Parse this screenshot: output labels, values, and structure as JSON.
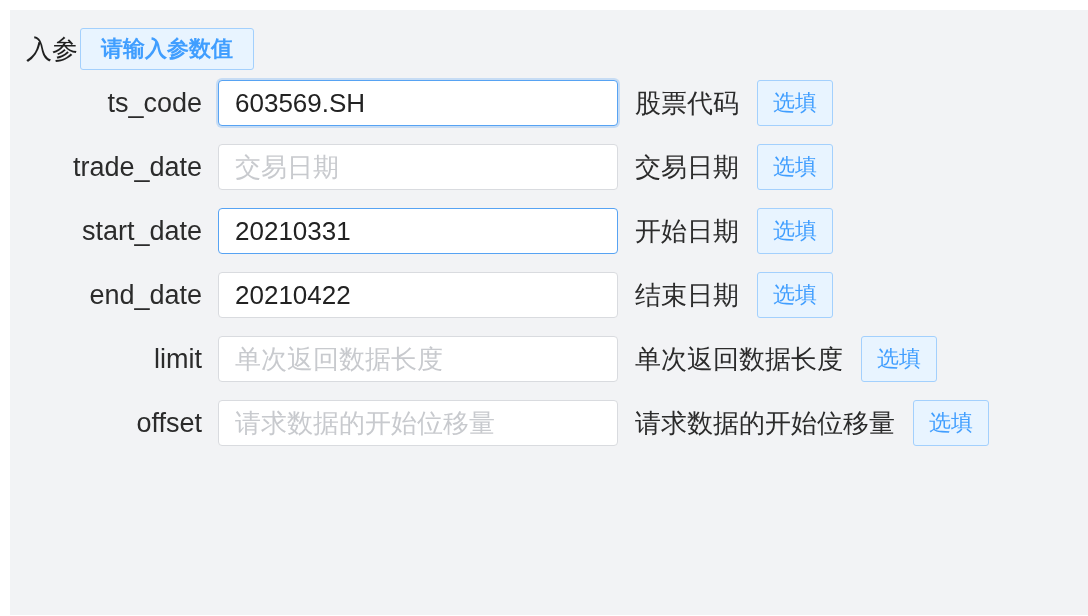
{
  "section": {
    "title": "入参",
    "hint_button": "请输入参数值"
  },
  "params": [
    {
      "name": "ts_code",
      "value": "603569.SH",
      "focused": true,
      "highlighted": true,
      "description": "股票代码",
      "tag": "选填"
    },
    {
      "name": "trade_date",
      "placeholder": "交易日期",
      "focused": false,
      "highlighted": false,
      "description": "交易日期",
      "tag": "选填"
    },
    {
      "name": "start_date",
      "value": "20210331",
      "focused": false,
      "highlighted": true,
      "description": "开始日期",
      "tag": "选填"
    },
    {
      "name": "end_date",
      "value": "20210422",
      "focused": false,
      "highlighted": false,
      "description": "结束日期",
      "tag": "选填"
    },
    {
      "name": "limit",
      "placeholder": "单次返回数据长度",
      "focused": false,
      "highlighted": false,
      "description": "单次返回数据长度",
      "tag": "选填"
    },
    {
      "name": "offset",
      "placeholder": "请求数据的开始位移量",
      "focused": false,
      "highlighted": false,
      "description": "请求数据的开始位移量",
      "tag": "选填"
    }
  ]
}
